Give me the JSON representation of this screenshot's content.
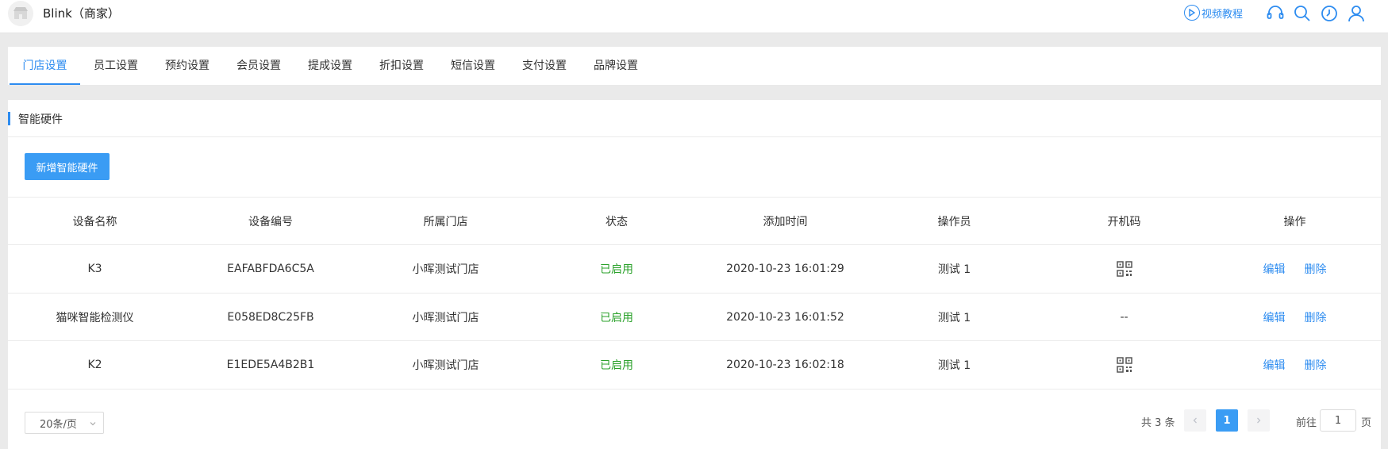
{
  "app": {
    "title": "Blink（商家）"
  },
  "header": {
    "video_link": "视频教程",
    "icons": [
      "headset-icon",
      "search-icon",
      "clock-icon",
      "user-icon"
    ]
  },
  "tabs": [
    {
      "label": "门店设置",
      "active": true
    },
    {
      "label": "员工设置",
      "active": false
    },
    {
      "label": "预约设置",
      "active": false
    },
    {
      "label": "会员设置",
      "active": false
    },
    {
      "label": "提成设置",
      "active": false
    },
    {
      "label": "折扣设置",
      "active": false
    },
    {
      "label": "短信设置",
      "active": false
    },
    {
      "label": "支付设置",
      "active": false
    },
    {
      "label": "品牌设置",
      "active": false
    }
  ],
  "section": {
    "title": "智能硬件",
    "add_button": "新增智能硬件"
  },
  "table": {
    "columns": [
      "设备名称",
      "设备编号",
      "所属门店",
      "状态",
      "添加时间",
      "操作员",
      "开机码",
      "操作"
    ],
    "rows": [
      {
        "name": "K3",
        "code": "EAFABFDA6C5A",
        "store": "小晖测试门店",
        "status": "已启用",
        "added": "2020-10-23 16:01:29",
        "operator": "测试 1",
        "boot_code": "qr-code-icon",
        "boot_text": ""
      },
      {
        "name": "猫咪智能检测仪",
        "code": "E058ED8C25FB",
        "store": "小晖测试门店",
        "status": "已启用",
        "added": "2020-10-23 16:01:52",
        "operator": "测试 1",
        "boot_code": "none",
        "boot_text": "--"
      },
      {
        "name": "K2",
        "code": "E1EDE5A4B2B1",
        "store": "小晖测试门店",
        "status": "已启用",
        "added": "2020-10-23 16:02:18",
        "operator": "测试 1",
        "boot_code": "qr-code-icon",
        "boot_text": ""
      }
    ],
    "actions": {
      "edit": "编辑",
      "delete": "删除"
    }
  },
  "pagination": {
    "page_size": "20条/页",
    "total": "共 3 条",
    "current": "1",
    "goto_label": "前往",
    "goto_value": "1",
    "goto_suffix": "页"
  },
  "colors": {
    "accent": "#2d8cf0",
    "button": "#3a9cf4",
    "status_on": "#2aa12a"
  }
}
